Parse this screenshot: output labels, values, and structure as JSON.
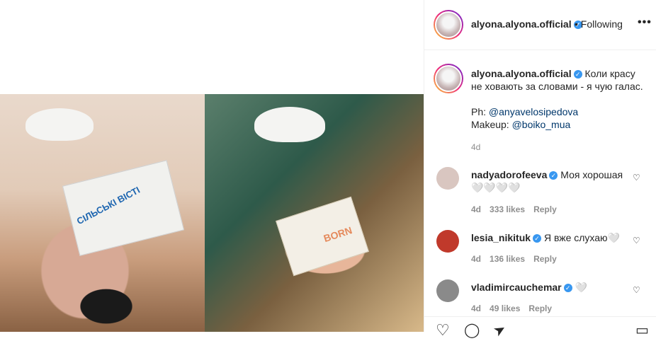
{
  "post": {
    "username": "alyona.alyona.official",
    "follow_status": "• Following",
    "more_icon": "•••",
    "caption_line1": "Коли красу",
    "caption_line2": "не ховають за словами - я чую галас.",
    "photo_credit_label": "Ph: ",
    "photo_credit_handle": "@anyavelosipedova",
    "makeup_label": "Makeup: ",
    "makeup_handle": "@boiko_mua",
    "caption_age": "4d",
    "newspaper_title": "СІЛЬСЬКІ ВІСТІ",
    "book_title": "BORN"
  },
  "comments": [
    {
      "user": "nadyadorofeeva",
      "text": "Моя хорошая",
      "text2": "🤍🤍🤍🤍",
      "age": "4d",
      "likes": "333 likes",
      "reply": "Reply",
      "avatar_color": "#d9c6c0"
    },
    {
      "user": "lesia_nikituk",
      "text": "Я вже слухаю🤍",
      "age": "4d",
      "likes": "136 likes",
      "reply": "Reply",
      "avatar_color": "#c0392b"
    },
    {
      "user": "vladimircauchemar",
      "text": "🤍",
      "age": "4d",
      "likes": "49 likes",
      "reply": "Reply",
      "avatar_color": "#8a8a8a"
    }
  ],
  "icons": {
    "verified": "✓",
    "heart": "♡",
    "like": "♡",
    "comment": "◯",
    "share": "➤",
    "save": "▭"
  }
}
